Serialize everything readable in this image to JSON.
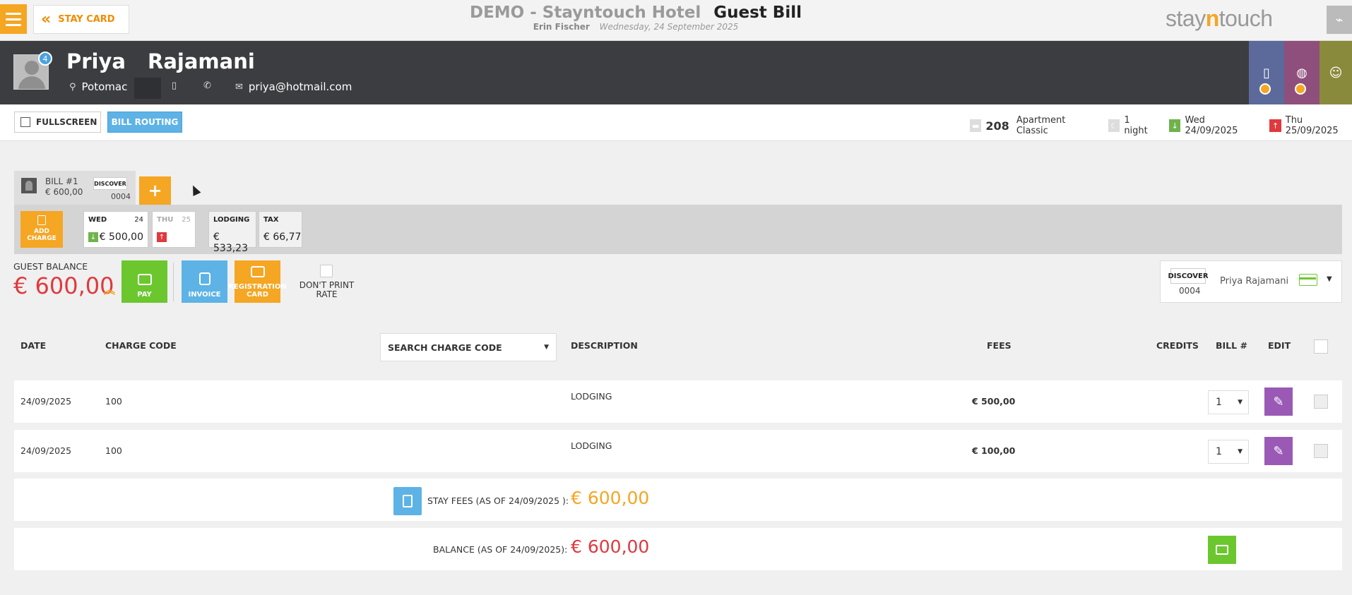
{
  "topbar": {
    "stay_card_label": "STAY CARD",
    "hotel_name": "DEMO - Stayntouch Hotel",
    "page_title": "Guest Bill",
    "user_name": "Erin Fischer",
    "business_date": "Wednesday, 24 September 2025",
    "logo_part1": "stay",
    "logo_part2": "n",
    "logo_part3": "touch"
  },
  "guest": {
    "first_name": "Priya",
    "last_name": "Rajamani",
    "badge_count": "4",
    "city": "Potomac",
    "email": "priya@hotmail.com"
  },
  "actions": {
    "fullscreen_label": "FULLSCREEN",
    "bill_routing_label": "BILL ROUTING"
  },
  "stay": {
    "room_number": "208",
    "room_type": "Apartment Classic",
    "nights": "1 night",
    "arrival": "Wed 24/09/2025",
    "departure": "Thu 25/09/2025"
  },
  "bill_tab": {
    "bill_number": "BILL #1",
    "amount": "€ 600,00",
    "card_brand": "DISCOVER",
    "card_digits": "0004",
    "add_label": "+"
  },
  "summary": {
    "add_charge_label1": "ADD",
    "add_charge_label2": "CHARGE",
    "days": [
      {
        "day": "WED",
        "date": "24",
        "amount": "€ 500,00"
      },
      {
        "day": "THU",
        "date": "25",
        "amount": ""
      }
    ],
    "lodging_label": "LODGING",
    "lodging_amount": "€ 533,23",
    "tax_label": "TAX",
    "tax_amount": "€ 66,77"
  },
  "balance": {
    "label": "GUEST BALANCE",
    "amount": "€ 600,00",
    "pay_label": "PAY",
    "invoice_label": "INVOICE",
    "registration_label1": "REGISTRATION",
    "registration_label2": "CARD",
    "dont_print_label1": "DON'T PRINT",
    "dont_print_label2": "RATE"
  },
  "payment_method": {
    "brand": "DISCOVER",
    "digits": "0004",
    "holder": "Priya Rajamani"
  },
  "table": {
    "headers": {
      "date": "DATE",
      "charge_code": "CHARGE CODE",
      "search_placeholder": "SEARCH CHARGE CODE",
      "description": "DESCRIPTION",
      "fees": "FEES",
      "credits": "CREDITS",
      "bill_no": "BILL #",
      "edit": "EDIT"
    },
    "rows": [
      {
        "date": "24/09/2025",
        "code": "100",
        "description": "LODGING",
        "fees": "€ 500,00",
        "bill": "1"
      },
      {
        "date": "24/09/2025",
        "code": "100",
        "description": "LODGING",
        "fees": "€ 100,00",
        "bill": "1"
      }
    ],
    "stay_fees_label": "STAY FEES (AS OF  24/09/2025 ):",
    "stay_fees_amount": "€ 600,00",
    "balance_label": "BALANCE (AS OF  24/09/2025):",
    "balance_amount": "€ 600,00"
  },
  "colors": {
    "accent_orange": "#f5a623",
    "balance_red": "#e0393e",
    "pay_green": "#6cc72f",
    "info_blue": "#5db3e6",
    "edit_purple": "#9b59b6",
    "header_dark": "#3c3d40"
  }
}
